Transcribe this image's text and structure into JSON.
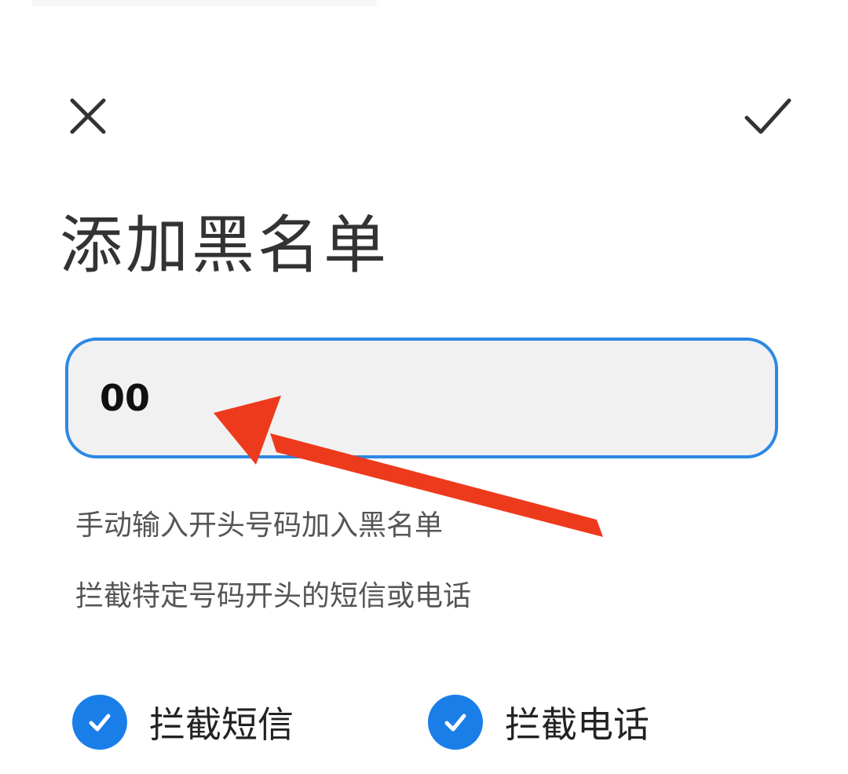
{
  "header": {
    "close_icon": "close-icon",
    "confirm_icon": "check-icon",
    "title": "添加黑名单"
  },
  "number_field": {
    "value": "00",
    "placeholder": ""
  },
  "hints": {
    "line1": "手动输入开头号码加入黑名单",
    "line2": "拦截特定号码开头的短信或电话"
  },
  "options": {
    "block_sms": {
      "label": "拦截短信",
      "checked": true
    },
    "block_call": {
      "label": "拦截电话",
      "checked": true
    }
  },
  "colors": {
    "accent": "#1a7ee8",
    "field_border": "#2b88e4",
    "field_bg": "#f1f1f1",
    "annotation_arrow": "#ee3a1c"
  }
}
